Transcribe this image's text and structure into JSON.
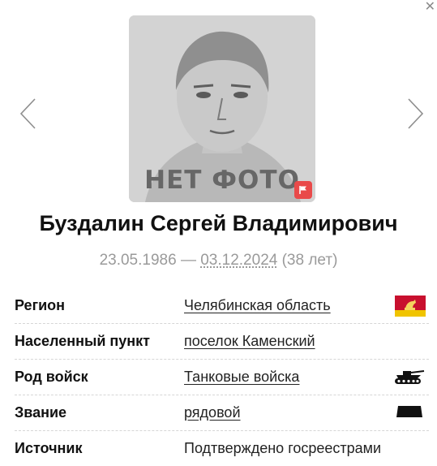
{
  "dialog": {
    "close_icon": "close-icon"
  },
  "gallery": {
    "prev_icon": "chevron-left-icon",
    "next_icon": "chevron-right-icon",
    "no_photo_label": "НЕТ ФОТО",
    "report_icon": "flag-icon"
  },
  "person": {
    "name": "Буздалин Сергей Владимирович",
    "birth_date": "23.05.1986",
    "separator": "—",
    "death_date": "03.12.2024",
    "age": "(38 лет)"
  },
  "details": {
    "region": {
      "label": "Регион",
      "value": "Челябинская область",
      "icon": "region-flag-icon",
      "colors": [
        "#c8102e",
        "#f0c400"
      ]
    },
    "settlement": {
      "label": "Населенный пункт",
      "value": "поселок Каменский"
    },
    "branch": {
      "label": "Род войск",
      "value": "Танковые войска",
      "icon": "tank-icon"
    },
    "rank": {
      "label": "Звание",
      "value": "рядовой",
      "icon": "rank-insignia-icon"
    },
    "source": {
      "label": "Источник",
      "value": "Подтверждено госреестрами"
    }
  },
  "colors": {
    "badge": "#e94a4a",
    "muted_text": "#9a9a9a",
    "photo_bg": "#cfcfcf"
  }
}
